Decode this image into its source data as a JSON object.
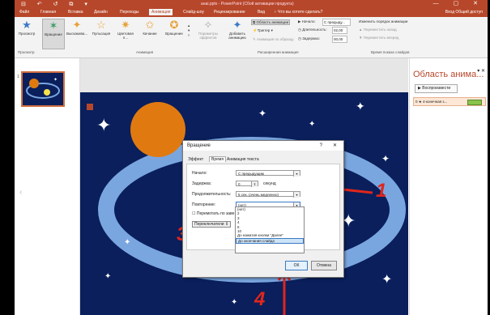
{
  "titlebar": {
    "quick_access": "⊟ ↶ ↺ ⧉ ▾",
    "title": "анаі.pptx - PowerPoint (Сбой активации продукта)",
    "window_buttons": "— ▢ ✕"
  },
  "tabs": [
    "Файл",
    "Главная",
    "Вставка",
    "Дизайн",
    "Переходы",
    "Анимация",
    "Слайд-шоу",
    "Рецензирование",
    "Вид"
  ],
  "tell_me": "Что вы хотите сделать?",
  "account": "Вход  Общий доступ",
  "ribbon": {
    "preview": "Просмотр",
    "preview_group": "Просмотр",
    "effects": [
      "Вращение",
      "Выскакива...",
      "Пульсация",
      "Цветовая п...",
      "Качание",
      "Вращение"
    ],
    "effects_group": "Анимация",
    "params": "Параметры эффектов",
    "add_anim": "Добавить анимацию",
    "anim_pane_btn": "Область анимации",
    "trigger": "Триггер",
    "anim_painter": "Анимация по образцу",
    "ext_group": "Расширенная анимация",
    "start_label": "Начало:",
    "start_value": "С предыду...",
    "duration_label": "Длительность:",
    "duration_value": "02,00",
    "delay_label": "Задержка:",
    "delay_value": "00,00",
    "reorder": "Изменить порядок анимации",
    "move_earlier": "Переместить назад",
    "move_later": "Переместить вперед",
    "timing_group": "Время показа слайдов"
  },
  "thumbnail": {
    "number": "1"
  },
  "anim_pane": {
    "title": "Область анима...",
    "play": "Воспроизвести",
    "item": "0 ★ 4-конечная з..."
  },
  "dialog": {
    "title": "Вращение",
    "help": "?",
    "close": "✕",
    "tabs": [
      "Эффект",
      "Время",
      "Анимация текста"
    ],
    "start_label": "Начало:",
    "start_value": "С предыдущим",
    "delay_label": "Задержка:",
    "delay_value": "0",
    "delay_unit": "секунд",
    "duration_label": "Продолжительность:",
    "duration_value": "5 сек. (очень медленно)",
    "repeat_label": "Повторение:",
    "repeat_value": "(нет)",
    "rewind_label": "Перемотать по заве",
    "triggers_label": "Переключатели",
    "options": [
      "(нет)",
      "2",
      "3",
      "4",
      "5",
      "10",
      "До нажатия кнопки \"Далее\"",
      "До окончания слайда"
    ],
    "ok": "ОК",
    "cancel": "Отмена"
  },
  "annotations": [
    "1",
    "2",
    "3",
    "4"
  ],
  "colors": {
    "accent": "#b7472a",
    "annotation": "#e0261c",
    "slide_bg": "#0a1f5c",
    "sun": "#e07a10",
    "ring": "#7aa6e0"
  }
}
